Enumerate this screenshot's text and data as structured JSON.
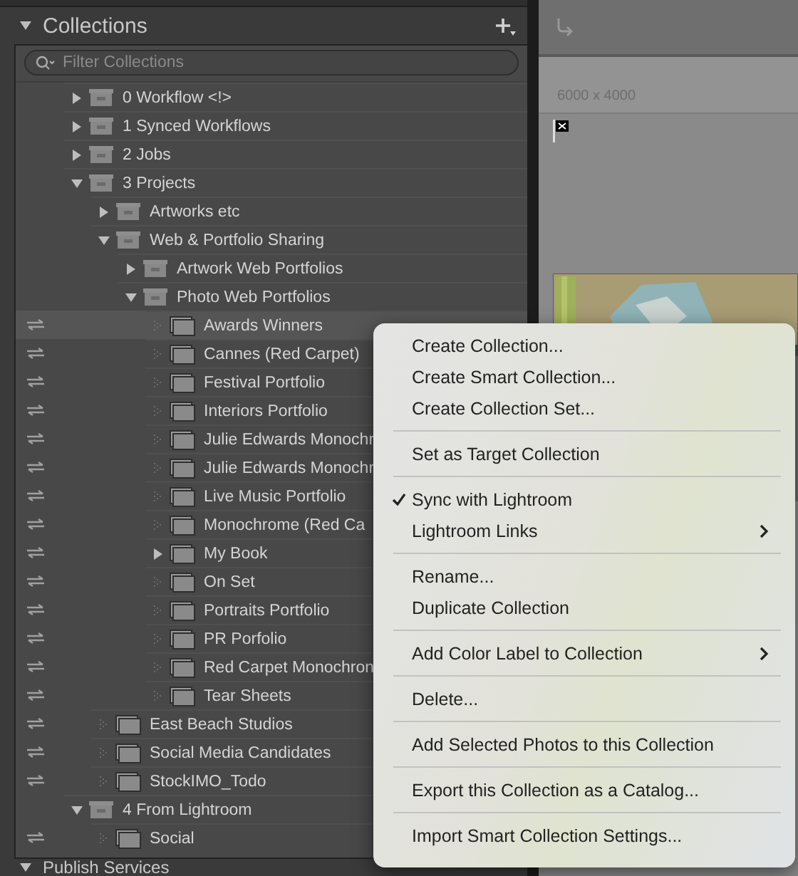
{
  "panel": {
    "title": "Collections",
    "expanded": true,
    "filter": {
      "placeholder": "Filter Collections"
    },
    "tree": [
      {
        "name": "0 Workflow <!>",
        "kind": "set",
        "expanded": false,
        "synced": false,
        "selected": false
      },
      {
        "name": "1 Synced Workflows",
        "kind": "set",
        "expanded": false,
        "synced": false,
        "selected": false
      },
      {
        "name": "2 Jobs",
        "kind": "set",
        "expanded": false,
        "synced": false,
        "selected": false
      },
      {
        "name": "3 Projects",
        "kind": "set",
        "expanded": true,
        "synced": false,
        "selected": false,
        "children": [
          {
            "name": "Artworks etc",
            "kind": "set",
            "expanded": false,
            "synced": false,
            "selected": false
          },
          {
            "name": "Web & Portfolio Sharing",
            "kind": "set",
            "expanded": true,
            "synced": false,
            "selected": false,
            "children": [
              {
                "name": "Artwork Web Portfolios",
                "kind": "set",
                "expanded": false,
                "synced": false,
                "selected": false
              },
              {
                "name": "Photo Web Portfolios",
                "kind": "set",
                "expanded": true,
                "synced": false,
                "selected": false,
                "children": [
                  {
                    "name": "Awards Winners",
                    "kind": "collection",
                    "synced": true,
                    "selected": true
                  },
                  {
                    "name": "Cannes (Red Carpet)",
                    "kind": "collection",
                    "synced": true,
                    "selected": false
                  },
                  {
                    "name": "Festival Portfolio",
                    "kind": "collection",
                    "synced": true,
                    "selected": false
                  },
                  {
                    "name": "Interiors Portfolio",
                    "kind": "collection",
                    "synced": true,
                    "selected": false
                  },
                  {
                    "name": "Julie Edwards Monochr",
                    "kind": "collection",
                    "synced": true,
                    "selected": false
                  },
                  {
                    "name": "Julie Edwards Monochr",
                    "kind": "collection",
                    "synced": true,
                    "selected": false
                  },
                  {
                    "name": "Live Music Portfolio",
                    "kind": "collection",
                    "synced": true,
                    "selected": false
                  },
                  {
                    "name": "Monochrome (Red Ca",
                    "kind": "collection",
                    "synced": true,
                    "selected": false
                  },
                  {
                    "name": "My Book",
                    "kind": "collection",
                    "expanded": false,
                    "synced": true,
                    "selected": false
                  },
                  {
                    "name": "On Set",
                    "kind": "collection",
                    "synced": true,
                    "selected": false
                  },
                  {
                    "name": "Portraits Portfolio",
                    "kind": "collection",
                    "synced": true,
                    "selected": false
                  },
                  {
                    "name": "PR Porfolio",
                    "kind": "collection",
                    "synced": true,
                    "selected": false
                  },
                  {
                    "name": "Red Carpet Monochron",
                    "kind": "collection",
                    "synced": true,
                    "selected": false
                  },
                  {
                    "name": "Tear Sheets",
                    "kind": "collection",
                    "synced": true,
                    "selected": false
                  }
                ]
              }
            ]
          },
          {
            "name": "East Beach Studios",
            "kind": "collection",
            "synced": true,
            "selected": false
          },
          {
            "name": "Social Media Candidates",
            "kind": "collection",
            "synced": true,
            "selected": false
          },
          {
            "name": "StockIMO_Todo",
            "kind": "collection",
            "synced": true,
            "selected": false
          }
        ]
      },
      {
        "name": "4 From Lightroom",
        "kind": "set",
        "expanded": true,
        "synced": false,
        "selected": false,
        "children": [
          {
            "name": "Social",
            "kind": "collection",
            "synced": true,
            "selected": false
          }
        ]
      }
    ]
  },
  "next_panel": {
    "title": "Publish Services",
    "expanded": true
  },
  "preview": {
    "dimensions": "6000 x 4000"
  },
  "context_menu": {
    "groups": [
      [
        {
          "label": "Create Collection...",
          "checked": false,
          "submenu": false
        },
        {
          "label": "Create Smart Collection...",
          "checked": false,
          "submenu": false
        },
        {
          "label": "Create Collection Set...",
          "checked": false,
          "submenu": false
        }
      ],
      [
        {
          "label": "Set as Target Collection",
          "checked": false,
          "submenu": false
        }
      ],
      [
        {
          "label": "Sync with Lightroom",
          "checked": true,
          "submenu": false
        },
        {
          "label": "Lightroom Links",
          "checked": false,
          "submenu": true
        }
      ],
      [
        {
          "label": "Rename...",
          "checked": false,
          "submenu": false
        },
        {
          "label": "Duplicate Collection",
          "checked": false,
          "submenu": false
        }
      ],
      [
        {
          "label": "Add Color Label to Collection",
          "checked": false,
          "submenu": true
        }
      ],
      [
        {
          "label": "Delete...",
          "checked": false,
          "submenu": false
        }
      ],
      [
        {
          "label": "Add Selected Photos to this Collection",
          "checked": false,
          "submenu": false
        }
      ],
      [
        {
          "label": "Export this Collection as a Catalog...",
          "checked": false,
          "submenu": false
        }
      ],
      [
        {
          "label": "Import Smart Collection Settings...",
          "checked": false,
          "submenu": false
        }
      ]
    ]
  }
}
